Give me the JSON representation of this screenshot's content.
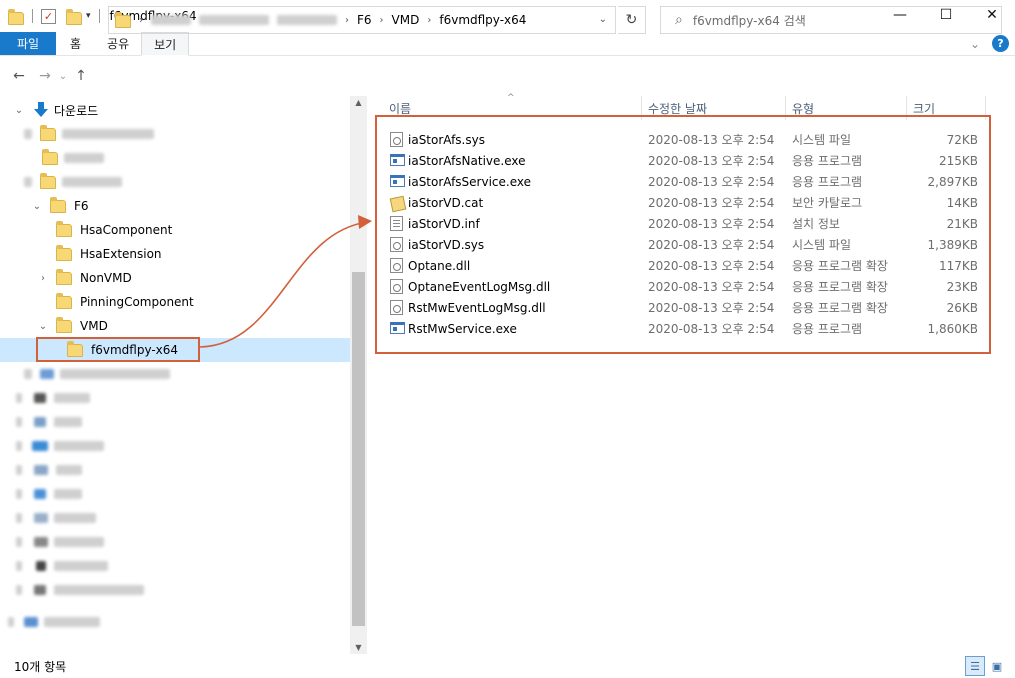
{
  "window": {
    "title": "f6vmdflpy-x64",
    "minimize": "—",
    "maximize": "☐",
    "close": "✕"
  },
  "ribbon": {
    "tabs": [
      "파일",
      "홈",
      "공유",
      "보기"
    ],
    "expand": "⌄",
    "help": "?"
  },
  "nav": {
    "back": "←",
    "forward": "→",
    "recent": "⌄",
    "up": "↑",
    "refresh": "↻"
  },
  "address": {
    "crumbs": [
      "F6",
      "VMD",
      "f6vmdflpy-x64"
    ],
    "separator": "›"
  },
  "search": {
    "placeholder": "f6vmdflpy-x64 검색",
    "icon": "⌕"
  },
  "tree": {
    "downloads": "다운로드",
    "f6": "F6",
    "hsacomponent": "HsaComponent",
    "hsaextension": "HsaExtension",
    "nonvmd": "NonVMD",
    "pinning": "PinningComponent",
    "vmd": "VMD",
    "selected": "f6vmdflpy-x64"
  },
  "columns": {
    "name": "이름",
    "date": "수정한 날짜",
    "type": "유형",
    "size": "크기"
  },
  "files": [
    {
      "name": "iaStorAfs.sys",
      "date": "2020-08-13 오후 2:54",
      "type": "시스템 파일",
      "size": "72KB",
      "icon": "sys"
    },
    {
      "name": "iaStorAfsNative.exe",
      "date": "2020-08-13 오후 2:54",
      "type": "응용 프로그램",
      "size": "215KB",
      "icon": "exe"
    },
    {
      "name": "iaStorAfsService.exe",
      "date": "2020-08-13 오후 2:54",
      "type": "응용 프로그램",
      "size": "2,897KB",
      "icon": "exe"
    },
    {
      "name": "iaStorVD.cat",
      "date": "2020-08-13 오후 2:54",
      "type": "보안 카탈로그",
      "size": "14KB",
      "icon": "cat"
    },
    {
      "name": "iaStorVD.inf",
      "date": "2020-08-13 오후 2:54",
      "type": "설치 정보",
      "size": "21KB",
      "icon": "inf"
    },
    {
      "name": "iaStorVD.sys",
      "date": "2020-08-13 오후 2:54",
      "type": "시스템 파일",
      "size": "1,389KB",
      "icon": "sys"
    },
    {
      "name": "Optane.dll",
      "date": "2020-08-13 오후 2:54",
      "type": "응용 프로그램 확장",
      "size": "117KB",
      "icon": "dll"
    },
    {
      "name": "OptaneEventLogMsg.dll",
      "date": "2020-08-13 오후 2:54",
      "type": "응용 프로그램 확장",
      "size": "23KB",
      "icon": "dll"
    },
    {
      "name": "RstMwEventLogMsg.dll",
      "date": "2020-08-13 오후 2:54",
      "type": "응용 프로그램 확장",
      "size": "26KB",
      "icon": "dll"
    },
    {
      "name": "RstMwService.exe",
      "date": "2020-08-13 오후 2:54",
      "type": "응용 프로그램",
      "size": "1,860KB",
      "icon": "exe"
    }
  ],
  "status": {
    "count": "10개 항목"
  },
  "colors": {
    "accent": "#1979ca",
    "selection": "#cce8ff",
    "annotation": "#d2603a"
  }
}
